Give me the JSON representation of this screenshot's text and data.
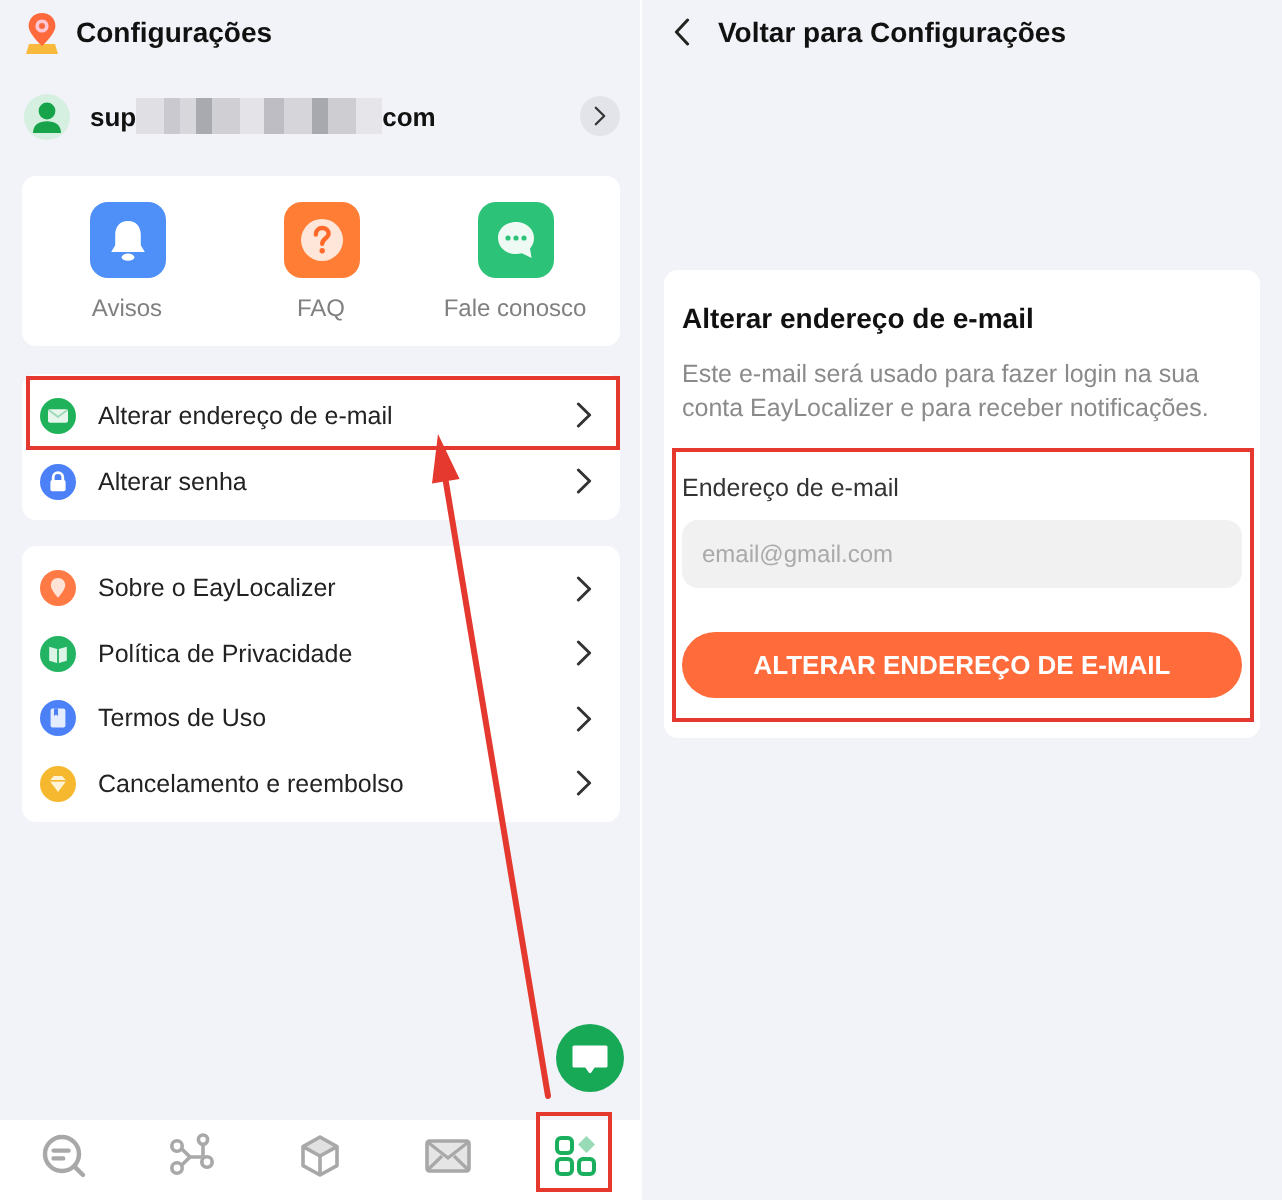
{
  "settings_screen": {
    "title": "Configurações",
    "account": {
      "email_start": "sup",
      "email_end": "com"
    },
    "shortcuts": [
      {
        "label": "Avisos"
      },
      {
        "label": "FAQ"
      },
      {
        "label": "Fale conosco"
      }
    ],
    "menu_groups": [
      {
        "items": [
          {
            "label": "Alterar endereço de e-mail",
            "highlighted": true
          },
          {
            "label": "Alterar senha",
            "highlighted": false
          }
        ]
      },
      {
        "items": [
          {
            "label": "Sobre o EayLocalizer",
            "highlighted": false
          },
          {
            "label": "Política de Privacidade",
            "highlighted": false
          },
          {
            "label": "Termos de Uso",
            "highlighted": false
          },
          {
            "label": "Cancelamento e reembolso",
            "highlighted": false
          }
        ]
      }
    ],
    "bottom_nav": [
      {
        "selected": false,
        "highlighted": false
      },
      {
        "selected": false,
        "highlighted": false
      },
      {
        "selected": false,
        "highlighted": false
      },
      {
        "selected": false,
        "highlighted": false
      },
      {
        "selected": true,
        "highlighted": true
      }
    ]
  },
  "email_screen": {
    "back_label": "Voltar para Configurações",
    "card": {
      "title": "Alterar endereço de e-mail",
      "description": "Este e-mail será usado para fazer login na sua conta EayLocalizer e para receber notificações.",
      "form": {
        "highlighted": true,
        "field_label": "Endereço de e-mail",
        "placeholder": "email@gmail.com",
        "button": "ALTERAR ENDEREÇO DE E-MAIL"
      }
    }
  }
}
